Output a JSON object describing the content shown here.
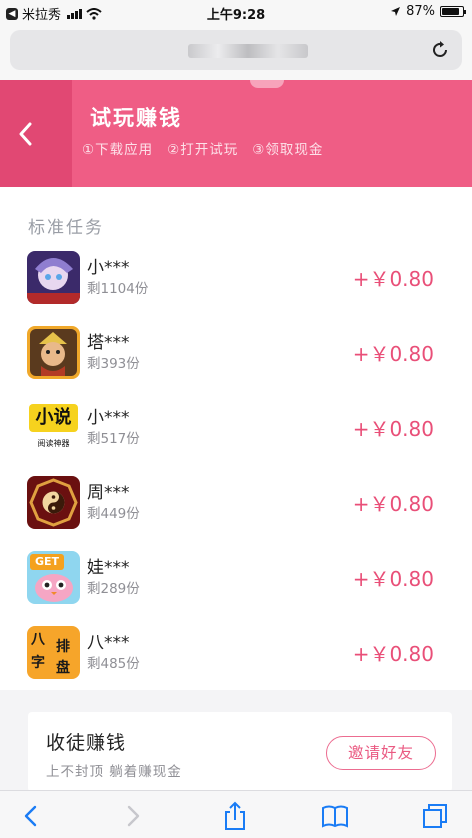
{
  "status_bar": {
    "back_app": "米拉秀",
    "time": "上午9:28",
    "battery": "87%",
    "battery_level": 0.87
  },
  "header": {
    "title": "试玩赚钱",
    "steps": [
      "①下载应用",
      "②打开试玩",
      "③领取现金"
    ]
  },
  "section_title": "标准任务",
  "tasks": [
    {
      "name": "小***",
      "remaining": "剩1104份",
      "reward": "+￥0.80",
      "icon": "anime-character-game-icon"
    },
    {
      "name": "塔***",
      "remaining": "剩393份",
      "reward": "+￥0.80",
      "icon": "warrior-game-icon"
    },
    {
      "name": "小***",
      "remaining": "剩517份",
      "reward": "+￥0.80",
      "icon": "novel-reader-icon",
      "icon_text": "小说",
      "icon_subtext": "阅读神器"
    },
    {
      "name": "周***",
      "remaining": "剩449份",
      "reward": "+￥0.80",
      "icon": "bagua-yinyang-icon"
    },
    {
      "name": "娃***",
      "remaining": "剩289份",
      "reward": "+￥0.80",
      "icon": "cute-bird-game-icon",
      "icon_text": "GET"
    },
    {
      "name": "八***",
      "remaining": "剩485份",
      "reward": "+￥0.80",
      "icon": "bazi-paipan-icon",
      "icon_chars": [
        "八",
        "字",
        "排",
        "盘"
      ]
    }
  ],
  "recruit": {
    "title": "收徒赚钱",
    "subtitle": "上不封顶 躺着赚现金",
    "button": "邀请好友"
  },
  "colors": {
    "header_pink": "#ef5d85",
    "header_back_pink": "#e14873",
    "reward_pink": "#e94f78",
    "ios_blue": "#1a7cf5"
  }
}
